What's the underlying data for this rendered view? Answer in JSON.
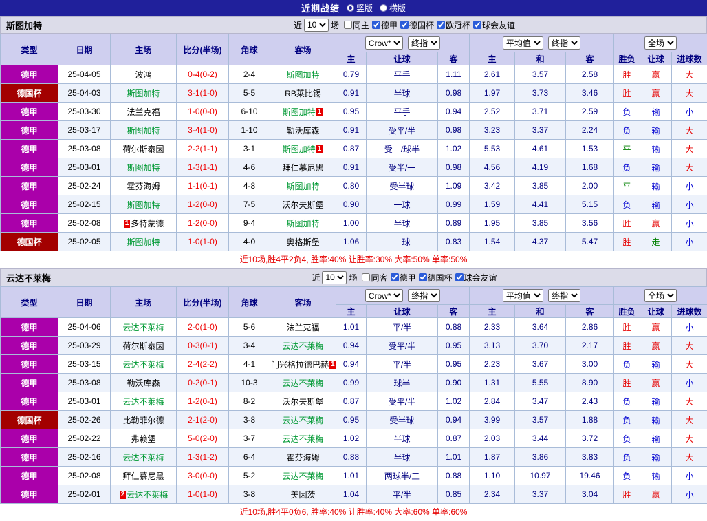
{
  "top_bar": {
    "title": "近期战绩",
    "options": [
      {
        "label": "竖版",
        "selected": true
      },
      {
        "label": "横版",
        "selected": false
      }
    ]
  },
  "colors": {
    "league_badge": "#aa00aa",
    "cup_badge": "#a30000",
    "win": "#e60000",
    "draw": "#008000",
    "loss": "#0000d0",
    "focus_team": "#009933",
    "score": "#ee0000"
  },
  "sections": [
    {
      "team": "斯图加特",
      "filter": {
        "prefix": "近",
        "count": "10",
        "suffix": "场",
        "checkboxes": [
          {
            "label": "同主",
            "checked": false
          },
          {
            "label": "德甲",
            "checked": true
          },
          {
            "label": "德国杯",
            "checked": true
          },
          {
            "label": "欧冠杯",
            "checked": true
          },
          {
            "label": "球会友谊",
            "checked": true
          }
        ]
      },
      "table": {
        "headers": [
          "类型",
          "日期",
          "主场",
          "比分(半场)",
          "角球",
          "客场"
        ],
        "selects": [
          "Crow*",
          "终指",
          "平均值",
          "终指",
          "全场"
        ],
        "sub_headers": [
          "主",
          "让球",
          "客",
          "主",
          "和",
          "客",
          "胜负",
          "让球",
          "进球数"
        ],
        "rows": [
          {
            "type": "德甲",
            "type_style": "league",
            "date": "25-04-05",
            "home": {
              "name": "波鸿",
              "focus": false,
              "mark": ""
            },
            "score": "0-4(0-2)",
            "corner": "2-4",
            "away": {
              "name": "斯图加特",
              "focus": true,
              "mark": ""
            },
            "odds": [
              "0.79",
              "平手",
              "1.11"
            ],
            "avg": [
              "2.61",
              "3.57",
              "2.58"
            ],
            "results": [
              "胜",
              "赢",
              "大"
            ]
          },
          {
            "type": "德国杯",
            "type_style": "cup",
            "date": "25-04-03",
            "home": {
              "name": "斯图加特",
              "focus": true,
              "mark": ""
            },
            "score": "3-1(1-0)",
            "corner": "5-5",
            "away": {
              "name": "RB莱比锡",
              "focus": false,
              "mark": ""
            },
            "odds": [
              "0.91",
              "半球",
              "0.98"
            ],
            "avg": [
              "1.97",
              "3.73",
              "3.46"
            ],
            "results": [
              "胜",
              "赢",
              "大"
            ]
          },
          {
            "type": "德甲",
            "type_style": "league",
            "date": "25-03-30",
            "home": {
              "name": "法兰克福",
              "focus": false,
              "mark": ""
            },
            "score": "1-0(0-0)",
            "corner": "6-10",
            "away": {
              "name": "斯图加特",
              "focus": true,
              "mark": "1"
            },
            "odds": [
              "0.95",
              "平手",
              "0.94"
            ],
            "avg": [
              "2.52",
              "3.71",
              "2.59"
            ],
            "results": [
              "负",
              "输",
              "小"
            ]
          },
          {
            "type": "德甲",
            "type_style": "league",
            "date": "25-03-17",
            "home": {
              "name": "斯图加特",
              "focus": true,
              "mark": ""
            },
            "score": "3-4(1-0)",
            "corner": "1-10",
            "away": {
              "name": "勒沃库森",
              "focus": false,
              "mark": ""
            },
            "odds": [
              "0.91",
              "受平/半",
              "0.98"
            ],
            "avg": [
              "3.23",
              "3.37",
              "2.24"
            ],
            "results": [
              "负",
              "输",
              "大"
            ]
          },
          {
            "type": "德甲",
            "type_style": "league",
            "date": "25-03-08",
            "home": {
              "name": "荷尔斯泰因",
              "focus": false,
              "mark": ""
            },
            "score": "2-2(1-1)",
            "corner": "3-1",
            "away": {
              "name": "斯图加特",
              "focus": true,
              "mark": "1"
            },
            "odds": [
              "0.87",
              "受一/球半",
              "1.02"
            ],
            "avg": [
              "5.53",
              "4.61",
              "1.53"
            ],
            "results": [
              "平",
              "输",
              "大"
            ]
          },
          {
            "type": "德甲",
            "type_style": "league",
            "date": "25-03-01",
            "home": {
              "name": "斯图加特",
              "focus": true,
              "mark": ""
            },
            "score": "1-3(1-1)",
            "corner": "4-6",
            "away": {
              "name": "拜仁慕尼黑",
              "focus": false,
              "mark": ""
            },
            "odds": [
              "0.91",
              "受半/一",
              "0.98"
            ],
            "avg": [
              "4.56",
              "4.19",
              "1.68"
            ],
            "results": [
              "负",
              "输",
              "大"
            ]
          },
          {
            "type": "德甲",
            "type_style": "league",
            "date": "25-02-24",
            "home": {
              "name": "霍芬海姆",
              "focus": false,
              "mark": ""
            },
            "score": "1-1(0-1)",
            "corner": "4-8",
            "away": {
              "name": "斯图加特",
              "focus": true,
              "mark": ""
            },
            "odds": [
              "0.80",
              "受半球",
              "1.09"
            ],
            "avg": [
              "3.42",
              "3.85",
              "2.00"
            ],
            "results": [
              "平",
              "输",
              "小"
            ]
          },
          {
            "type": "德甲",
            "type_style": "league",
            "date": "25-02-15",
            "home": {
              "name": "斯图加特",
              "focus": true,
              "mark": ""
            },
            "score": "1-2(0-0)",
            "corner": "7-5",
            "away": {
              "name": "沃尔夫斯堡",
              "focus": false,
              "mark": ""
            },
            "odds": [
              "0.90",
              "一球",
              "0.99"
            ],
            "avg": [
              "1.59",
              "4.41",
              "5.15"
            ],
            "results": [
              "负",
              "输",
              "小"
            ]
          },
          {
            "type": "德甲",
            "type_style": "league",
            "date": "25-02-08",
            "home": {
              "name": "多特蒙德",
              "focus": false,
              "mark": "1"
            },
            "score": "1-2(0-0)",
            "corner": "9-4",
            "away": {
              "name": "斯图加特",
              "focus": true,
              "mark": ""
            },
            "odds": [
              "1.00",
              "半球",
              "0.89"
            ],
            "avg": [
              "1.95",
              "3.85",
              "3.56"
            ],
            "results": [
              "胜",
              "赢",
              "小"
            ]
          },
          {
            "type": "德国杯",
            "type_style": "cup",
            "date": "25-02-05",
            "home": {
              "name": "斯图加特",
              "focus": true,
              "mark": ""
            },
            "score": "1-0(1-0)",
            "corner": "4-0",
            "away": {
              "name": "奥格斯堡",
              "focus": false,
              "mark": ""
            },
            "odds": [
              "1.06",
              "一球",
              "0.83"
            ],
            "avg": [
              "1.54",
              "4.37",
              "5.47"
            ],
            "results": [
              "胜",
              "走",
              "小"
            ]
          }
        ]
      },
      "summary": "近10场,胜4平2负4, 胜率:40% 让胜率:30% 大率:50% 单率:50%"
    },
    {
      "team": "云达不莱梅",
      "filter": {
        "prefix": "近",
        "count": "10",
        "suffix": "场",
        "checkboxes": [
          {
            "label": "同客",
            "checked": false
          },
          {
            "label": "德甲",
            "checked": true
          },
          {
            "label": "德国杯",
            "checked": true
          },
          {
            "label": "球会友谊",
            "checked": true
          }
        ]
      },
      "table": {
        "headers": [
          "类型",
          "日期",
          "主场",
          "比分(半场)",
          "角球",
          "客场"
        ],
        "selects": [
          "Crow*",
          "终指",
          "平均值",
          "终指",
          "全场"
        ],
        "sub_headers": [
          "主",
          "让球",
          "客",
          "主",
          "和",
          "客",
          "胜负",
          "让球",
          "进球数"
        ],
        "rows": [
          {
            "type": "德甲",
            "type_style": "league",
            "date": "25-04-06",
            "home": {
              "name": "云达不莱梅",
              "focus": true,
              "mark": ""
            },
            "score": "2-0(1-0)",
            "corner": "5-6",
            "away": {
              "name": "法兰克福",
              "focus": false,
              "mark": ""
            },
            "odds": [
              "1.01",
              "平/半",
              "0.88"
            ],
            "avg": [
              "2.33",
              "3.64",
              "2.86"
            ],
            "results": [
              "胜",
              "赢",
              "小"
            ]
          },
          {
            "type": "德甲",
            "type_style": "league",
            "date": "25-03-29",
            "home": {
              "name": "荷尔斯泰因",
              "focus": false,
              "mark": ""
            },
            "score": "0-3(0-1)",
            "corner": "3-4",
            "away": {
              "name": "云达不莱梅",
              "focus": true,
              "mark": ""
            },
            "odds": [
              "0.94",
              "受平/半",
              "0.95"
            ],
            "avg": [
              "3.13",
              "3.70",
              "2.17"
            ],
            "results": [
              "胜",
              "赢",
              "大"
            ]
          },
          {
            "type": "德甲",
            "type_style": "league",
            "date": "25-03-15",
            "home": {
              "name": "云达不莱梅",
              "focus": true,
              "mark": ""
            },
            "score": "2-4(2-2)",
            "corner": "4-1",
            "away": {
              "name": "门兴格拉德巴赫",
              "focus": false,
              "mark": "1"
            },
            "odds": [
              "0.94",
              "平/半",
              "0.95"
            ],
            "avg": [
              "2.23",
              "3.67",
              "3.00"
            ],
            "results": [
              "负",
              "输",
              "大"
            ]
          },
          {
            "type": "德甲",
            "type_style": "league",
            "date": "25-03-08",
            "home": {
              "name": "勒沃库森",
              "focus": false,
              "mark": ""
            },
            "score": "0-2(0-1)",
            "corner": "10-3",
            "away": {
              "name": "云达不莱梅",
              "focus": true,
              "mark": ""
            },
            "odds": [
              "0.99",
              "球半",
              "0.90"
            ],
            "avg": [
              "1.31",
              "5.55",
              "8.90"
            ],
            "results": [
              "胜",
              "赢",
              "小"
            ]
          },
          {
            "type": "德甲",
            "type_style": "league",
            "date": "25-03-01",
            "home": {
              "name": "云达不莱梅",
              "focus": true,
              "mark": ""
            },
            "score": "1-2(0-1)",
            "corner": "8-2",
            "away": {
              "name": "沃尔夫斯堡",
              "focus": false,
              "mark": ""
            },
            "odds": [
              "0.87",
              "受平/半",
              "1.02"
            ],
            "avg": [
              "2.84",
              "3.47",
              "2.43"
            ],
            "results": [
              "负",
              "输",
              "大"
            ]
          },
          {
            "type": "德国杯",
            "type_style": "cup",
            "date": "25-02-26",
            "home": {
              "name": "比勒菲尔德",
              "focus": false,
              "mark": ""
            },
            "score": "2-1(2-0)",
            "corner": "3-8",
            "away": {
              "name": "云达不莱梅",
              "focus": true,
              "mark": ""
            },
            "odds": [
              "0.95",
              "受半球",
              "0.94"
            ],
            "avg": [
              "3.99",
              "3.57",
              "1.88"
            ],
            "results": [
              "负",
              "输",
              "大"
            ]
          },
          {
            "type": "德甲",
            "type_style": "league",
            "date": "25-02-22",
            "home": {
              "name": "弗赖堡",
              "focus": false,
              "mark": ""
            },
            "score": "5-0(2-0)",
            "corner": "3-7",
            "away": {
              "name": "云达不莱梅",
              "focus": true,
              "mark": ""
            },
            "odds": [
              "1.02",
              "半球",
              "0.87"
            ],
            "avg": [
              "2.03",
              "3.44",
              "3.72"
            ],
            "results": [
              "负",
              "输",
              "大"
            ]
          },
          {
            "type": "德甲",
            "type_style": "league",
            "date": "25-02-16",
            "home": {
              "name": "云达不莱梅",
              "focus": true,
              "mark": ""
            },
            "score": "1-3(1-2)",
            "corner": "6-4",
            "away": {
              "name": "霍芬海姆",
              "focus": false,
              "mark": ""
            },
            "odds": [
              "0.88",
              "半球",
              "1.01"
            ],
            "avg": [
              "1.87",
              "3.86",
              "3.83"
            ],
            "results": [
              "负",
              "输",
              "大"
            ]
          },
          {
            "type": "德甲",
            "type_style": "league",
            "date": "25-02-08",
            "home": {
              "name": "拜仁慕尼黑",
              "focus": false,
              "mark": ""
            },
            "score": "3-0(0-0)",
            "corner": "5-2",
            "away": {
              "name": "云达不莱梅",
              "focus": true,
              "mark": ""
            },
            "odds": [
              "1.01",
              "两球半/三",
              "0.88"
            ],
            "avg": [
              "1.10",
              "10.97",
              "19.46"
            ],
            "results": [
              "负",
              "输",
              "小"
            ]
          },
          {
            "type": "德甲",
            "type_style": "league",
            "date": "25-02-01",
            "home": {
              "name": "云达不莱梅",
              "focus": true,
              "mark": "2"
            },
            "score": "1-0(1-0)",
            "corner": "3-8",
            "away": {
              "name": "美因茨",
              "focus": false,
              "mark": ""
            },
            "odds": [
              "1.04",
              "平/半",
              "0.85"
            ],
            "avg": [
              "2.34",
              "3.37",
              "3.04"
            ],
            "results": [
              "胜",
              "赢",
              "小"
            ]
          }
        ]
      },
      "summary": "近10场,胜4平0负6, 胜率:40% 让胜率:40% 大率:60% 单率:60%"
    }
  ]
}
